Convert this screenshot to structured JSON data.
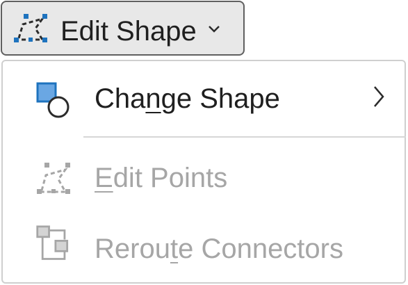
{
  "ribbon": {
    "edit_shape_label": "Edit Shape",
    "button_icon": "edit-points-icon",
    "dropdown_icon": "chevron-down-icon"
  },
  "menu": {
    "items": [
      {
        "label_pre": "Cha",
        "label_mnemonic": "n",
        "label_post": "ge Shape",
        "icon": "change-shape-icon",
        "has_submenu": true,
        "enabled": true
      },
      {
        "label_pre": "",
        "label_mnemonic": "E",
        "label_post": "dit Points",
        "icon": "edit-points-icon",
        "has_submenu": false,
        "enabled": false
      },
      {
        "label_pre": "Rerou",
        "label_mnemonic": "t",
        "label_post": "e Connectors",
        "icon": "reroute-connectors-icon",
        "has_submenu": false,
        "enabled": false
      }
    ]
  },
  "colors": {
    "accent_blue": "#1e73be",
    "text": "#1f1f1f",
    "disabled_text": "#a6a6a6",
    "button_bg": "#e8e8e8"
  }
}
